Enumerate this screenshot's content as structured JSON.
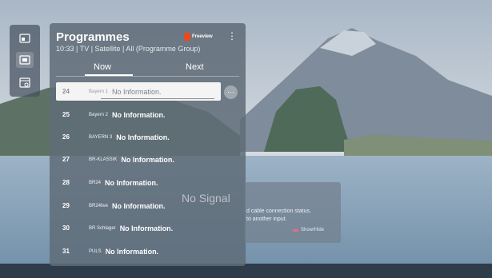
{
  "side_menu": {
    "items": [
      {
        "icon": "input-icon"
      },
      {
        "icon": "tv-guide-icon",
        "active": true
      },
      {
        "icon": "schedule-icon"
      }
    ]
  },
  "panel": {
    "title": "Programmes",
    "subtitle": "10:33 | TV | Satellite | All (Programme Group)",
    "brand": "Freeview",
    "menu_icon": "⋮",
    "tabs": [
      {
        "label": "Now",
        "selected": true
      },
      {
        "label": "Next",
        "selected": false
      }
    ],
    "channels": [
      {
        "number": "24",
        "name": "Bayern 1",
        "programme": "No Information.",
        "selected": true
      },
      {
        "number": "25",
        "name": "Bayern 2",
        "programme": "No Information."
      },
      {
        "number": "26",
        "name": "BAYERN 3",
        "programme": "No Information."
      },
      {
        "number": "27",
        "name": "BR-KLASSIK",
        "programme": "No Information."
      },
      {
        "number": "28",
        "name": "BR24",
        "programme": "No Information."
      },
      {
        "number": "29",
        "name": "BR24live",
        "programme": "No Information."
      },
      {
        "number": "30",
        "name": "BR Schlager",
        "programme": "No Information."
      },
      {
        "number": "31",
        "name": "PULS",
        "programme": "No Information."
      }
    ],
    "info_icon": "⋯"
  },
  "no_signal": {
    "title": "No Signal",
    "line1": "d cable connection status.",
    "line2": "to another input.",
    "show_hide": "Show/Hide"
  },
  "colors": {
    "panel": "#606c78",
    "selected_row": "#f4f4f4",
    "freeview": "#e84a1e",
    "show_hide": "#e86a8a"
  }
}
